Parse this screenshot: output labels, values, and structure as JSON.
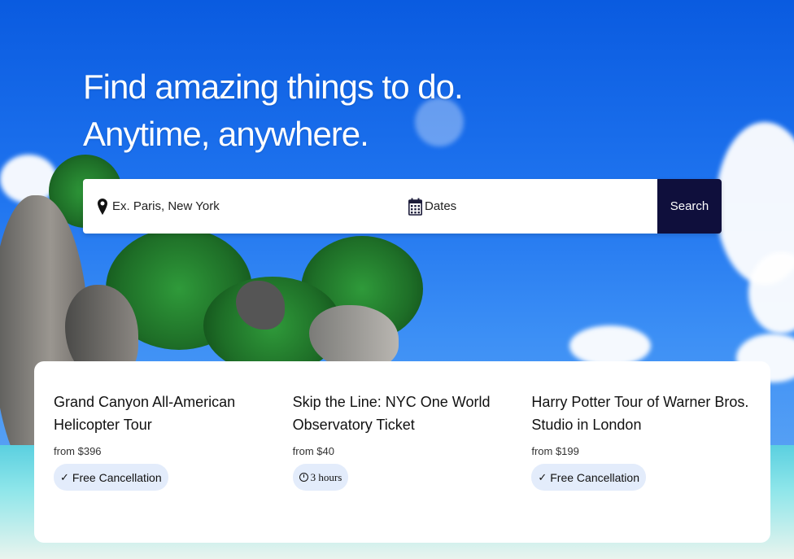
{
  "hero": {
    "line1": "Find amazing things to do.",
    "line2": "Anytime, anywhere."
  },
  "search": {
    "location_placeholder": "Ex. Paris, New York",
    "location_value": "",
    "dates_label": "Dates",
    "button_label": "Search",
    "icons": {
      "location": "map-pin-icon",
      "dates": "calendar-icon"
    },
    "button_color": "#0f0f3c"
  },
  "cards": [
    {
      "title": "Grand Canyon All-American Helicopter Tour",
      "price": "from $396",
      "badge": "Free Cancellation",
      "badge_icon": "check-icon"
    },
    {
      "title": "Skip the Line: NYC One World Observatory Ticket",
      "price": "from $40",
      "badge": "3 hours",
      "badge_icon": "clock-icon"
    },
    {
      "title": "Harry Potter Tour of Warner Bros. Studio in London",
      "price": "from $199",
      "badge": "Free Cancellation",
      "badge_icon": "check-icon"
    }
  ],
  "colors": {
    "badge_bg": "#e3ecfb",
    "sky": "#1a6fe0"
  }
}
